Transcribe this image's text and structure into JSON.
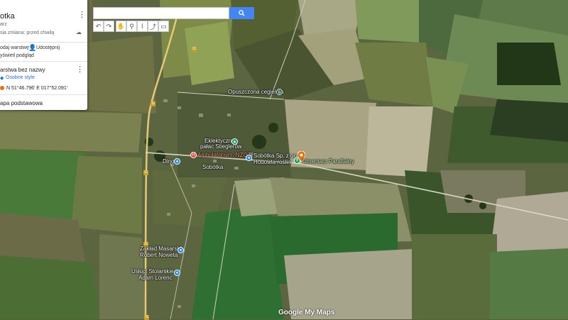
{
  "panel": {
    "map_title": "otka",
    "description": "arz",
    "last_edit": "sia zmiana: przed chwilą",
    "add_layer": "odaj warstwę",
    "share": "Udostępnij",
    "preview": "yświetl podgląd",
    "layer_title": "arstwa bez nazwy",
    "layer_style": "Osobne style",
    "coord_item": "N 51°46.796' E 017°52.091'",
    "base_map": "apa podstawowa"
  },
  "search": {
    "value": ""
  },
  "map_labels": {
    "cemetery_ruins": "Opuszczona cegielnia",
    "palace_1": "Eklektyczny",
    "palace_2": "pałac Stieglerów",
    "clinic": "Ambulatorium. NZOZ",
    "farm_1": "Sobótka Sp. z oo",
    "farm_2": "Hodowla roślin",
    "cemetery": "Cmentarz Parafialny",
    "dino": "Dino",
    "village": "Sobótka",
    "meat_1": "Zakład Masarski",
    "meat_2": "Robert Noweta",
    "carpenter_1": "Usługi Stolarskie",
    "carpenter_2": "Adam Lorenc",
    "road_11a": "11",
    "road_11b": "11",
    "road_11c": "11",
    "road_11d": "11",
    "road_11e": "11"
  },
  "watermark": "Google My Maps",
  "colors": {
    "accent": "#4285f4",
    "selected_pin": "#e8710a",
    "cemetery_pin": "#0f9d58"
  }
}
